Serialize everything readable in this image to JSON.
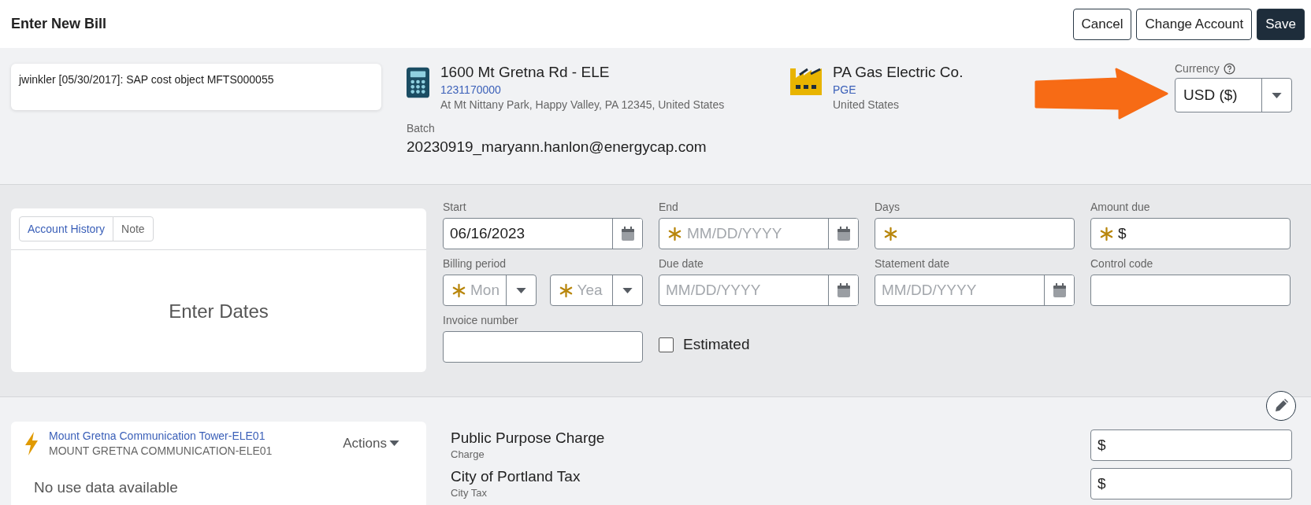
{
  "header": {
    "title": "Enter New Bill",
    "buttons": [
      {
        "label": "Cancel",
        "kind": "secondary"
      },
      {
        "label": "Change Account",
        "kind": "secondary"
      },
      {
        "label": "Save",
        "kind": "primary"
      }
    ]
  },
  "note": {
    "text": "jwinkler [05/30/2017]: SAP cost object MFTS000055"
  },
  "account": {
    "name": "1600 Mt Gretna Rd - ELE",
    "number": "1231170000",
    "address": "At Mt Nittany Park, Happy Valley, PA 12345, United States"
  },
  "vendor": {
    "name": "PA Gas Electric Co.",
    "code": "PGE",
    "address": "United States"
  },
  "currency": {
    "label": "Currency",
    "value": "USD ($)"
  },
  "batch": {
    "label": "Batch",
    "value": "20230919_maryann.hanlon@energycap.com"
  },
  "history": {
    "tabs": [
      {
        "label": "Account History",
        "selected": true
      },
      {
        "label": "Note",
        "selected": false
      }
    ],
    "message": "Enter Dates"
  },
  "fields": [
    {
      "kind": "date",
      "label": "Start",
      "value": "06/16/2023"
    },
    {
      "kind": "date",
      "label": "End",
      "placeholder": "MM/DD/YYYY",
      "required": true
    },
    {
      "kind": "text",
      "label": "Days",
      "required": true
    },
    {
      "kind": "text",
      "label": "Amount due",
      "prefix": "$",
      "required": true
    },
    {
      "kind": "period",
      "label": "Billing period",
      "parts": [
        {
          "placeholder": "Mon",
          "required": true
        },
        {
          "placeholder": "Yea",
          "required": true
        }
      ]
    },
    {
      "kind": "date",
      "label": "Due date",
      "placeholder": "MM/DD/YYYY"
    },
    {
      "kind": "date",
      "label": "Statement date",
      "placeholder": "MM/DD/YYYY"
    },
    {
      "kind": "text",
      "label": "Control code"
    },
    {
      "kind": "text",
      "label": "Invoice number"
    },
    {
      "kind": "checkbox",
      "label": "Estimated",
      "checked": false
    }
  ],
  "meter": {
    "name": "Mount Gretna Communication Tower-ELE01",
    "code": "MOUNT GRETNA COMMUNICATION-ELE01",
    "actions": "Actions",
    "message": "No use data available"
  },
  "charges": [
    {
      "name": "Public Purpose Charge",
      "type": "Charge",
      "prefix": "$"
    },
    {
      "name": "City of Portland Tax",
      "type": "City Tax",
      "prefix": "$"
    }
  ]
}
